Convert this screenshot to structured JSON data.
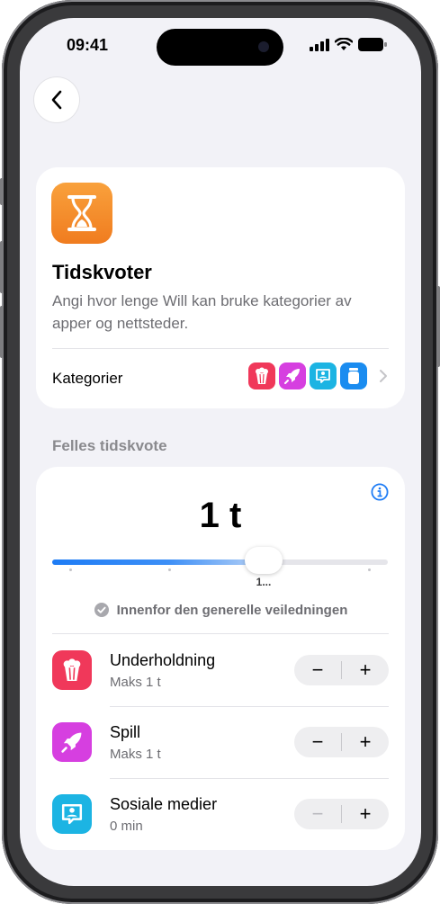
{
  "status_bar": {
    "time": "09:41"
  },
  "header": {
    "back_icon": "chevron-left-icon"
  },
  "summary_card": {
    "icon": "hourglass-icon",
    "icon_color": "#F28A2A",
    "title": "Tidskvoter",
    "description": "Angi hvor lenge Will kan bruke kategorier av apper og nettsteder.",
    "categories_label": "Kategorier",
    "category_icons": [
      "popcorn-icon",
      "rocket-icon",
      "chat-person-icon",
      "jar-icon"
    ]
  },
  "shared_limit": {
    "section_title": "Felles tidskvote",
    "value": "1 t",
    "slider_value_fraction": 0.63,
    "slider_thumb_label": "1...",
    "guideline_text": "Innenfor den generelle veiledningen",
    "accent": "#1E7CF5"
  },
  "categories": [
    {
      "name": "Underholdning",
      "limit": "Maks 1 t",
      "icon": "popcorn-icon",
      "color": "#F0385A",
      "minus": "−",
      "plus": "+",
      "minus_disabled": false
    },
    {
      "name": "Spill",
      "limit": "Maks 1 t",
      "icon": "rocket-icon",
      "color": "#D63FE0",
      "minus": "−",
      "plus": "+",
      "minus_disabled": false
    },
    {
      "name": "Sosiale medier",
      "limit": "0 min",
      "icon": "chat-person-icon",
      "color": "#1CB4E3",
      "minus": "−",
      "plus": "+",
      "minus_disabled": true
    }
  ]
}
